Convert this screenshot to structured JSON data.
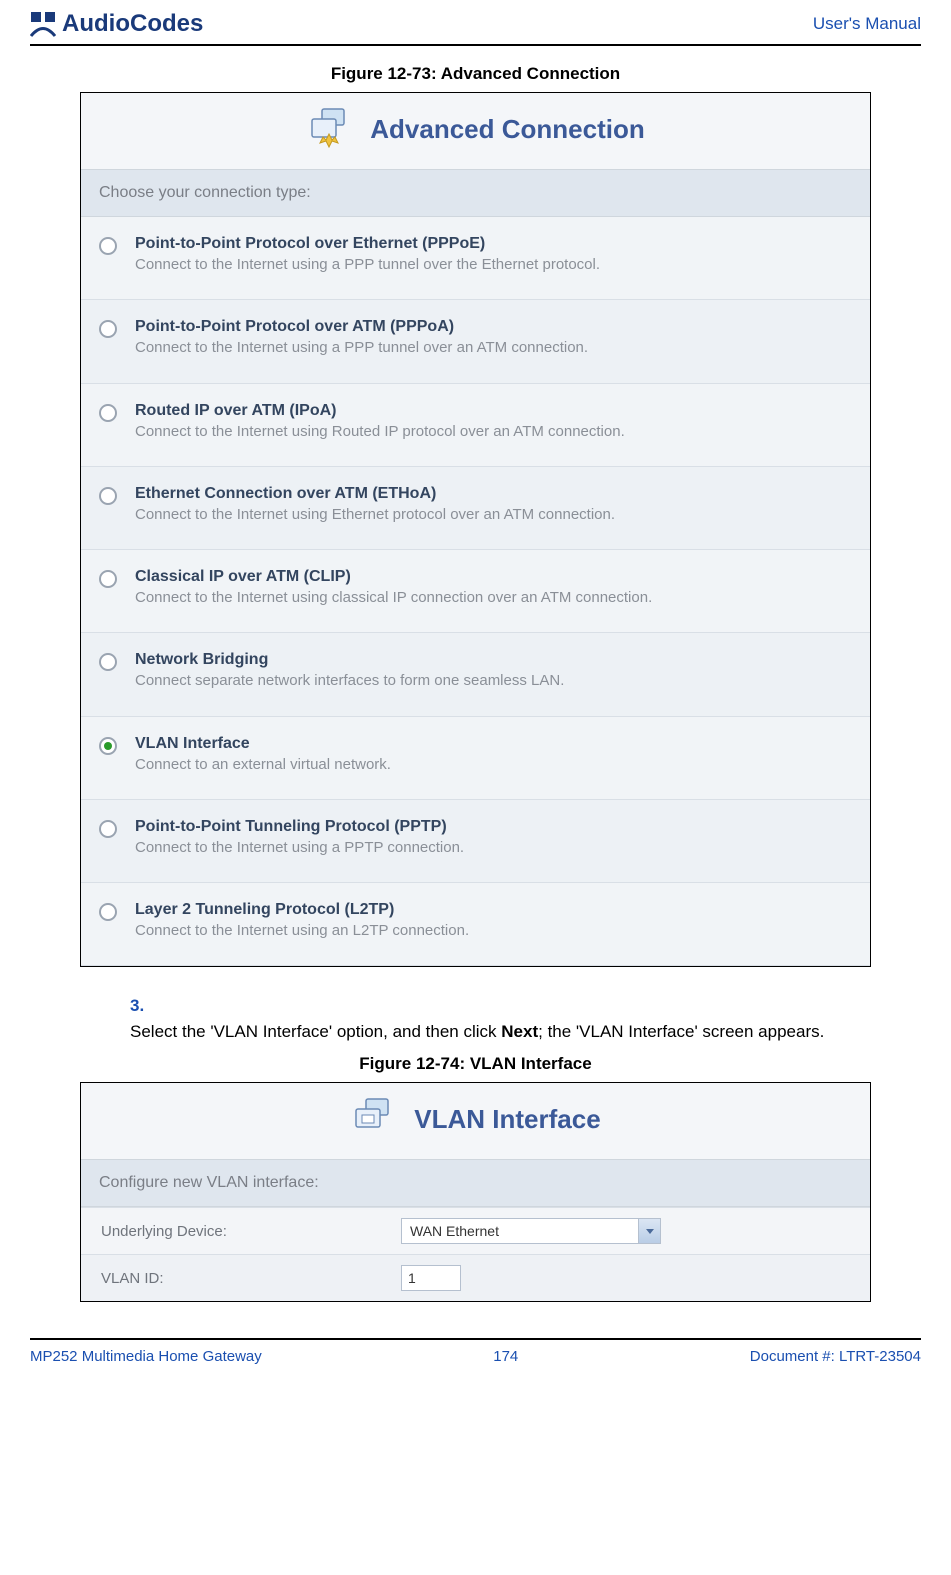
{
  "header": {
    "brand": "AudioCodes",
    "manual_label": "User's Manual"
  },
  "figure1": {
    "caption": "Figure 12-73: Advanced Connection",
    "panel_title": "Advanced Connection",
    "prompt": "Choose your connection type:",
    "options": [
      {
        "title": "Point-to-Point Protocol over Ethernet (PPPoE)",
        "desc": "Connect to the Internet using a PPP tunnel over the Ethernet protocol.",
        "selected": false
      },
      {
        "title": "Point-to-Point Protocol over ATM (PPPoA)",
        "desc": "Connect to the Internet using a PPP tunnel over an ATM connection.",
        "selected": false
      },
      {
        "title": "Routed IP over ATM (IPoA)",
        "desc": "Connect to the Internet using Routed IP protocol over an ATM connection.",
        "selected": false
      },
      {
        "title": "Ethernet Connection over ATM (ETHoA)",
        "desc": "Connect to the Internet using Ethernet protocol over an ATM connection.",
        "selected": false
      },
      {
        "title": "Classical IP over ATM (CLIP)",
        "desc": "Connect to the Internet using classical IP connection over an ATM connection.",
        "selected": false
      },
      {
        "title": "Network Bridging",
        "desc": "Connect separate network interfaces to form one seamless LAN.",
        "selected": false
      },
      {
        "title": "VLAN Interface",
        "desc": "Connect to an external virtual network.",
        "selected": true
      },
      {
        "title": "Point-to-Point Tunneling Protocol (PPTP)",
        "desc": "Connect to the Internet using a PPTP connection.",
        "selected": false
      },
      {
        "title": "Layer 2 Tunneling Protocol (L2TP)",
        "desc": "Connect to the Internet using an L2TP connection.",
        "selected": false
      }
    ]
  },
  "instruction": {
    "number": "3.",
    "text_before": "Select the 'VLAN Interface' option, and then click ",
    "bold": "Next",
    "text_after": "; the 'VLAN Interface' screen appears."
  },
  "figure2": {
    "caption": "Figure 12-74: VLAN Interface",
    "panel_title": "VLAN Interface",
    "prompt": "Configure new VLAN interface:",
    "rows": {
      "device_label": "Underlying Device:",
      "device_value": "WAN Ethernet",
      "vlan_label": "VLAN ID:",
      "vlan_value": "1"
    }
  },
  "footer": {
    "left": "MP252 Multimedia Home Gateway",
    "center": "174",
    "right": "Document #: LTRT-23504"
  }
}
